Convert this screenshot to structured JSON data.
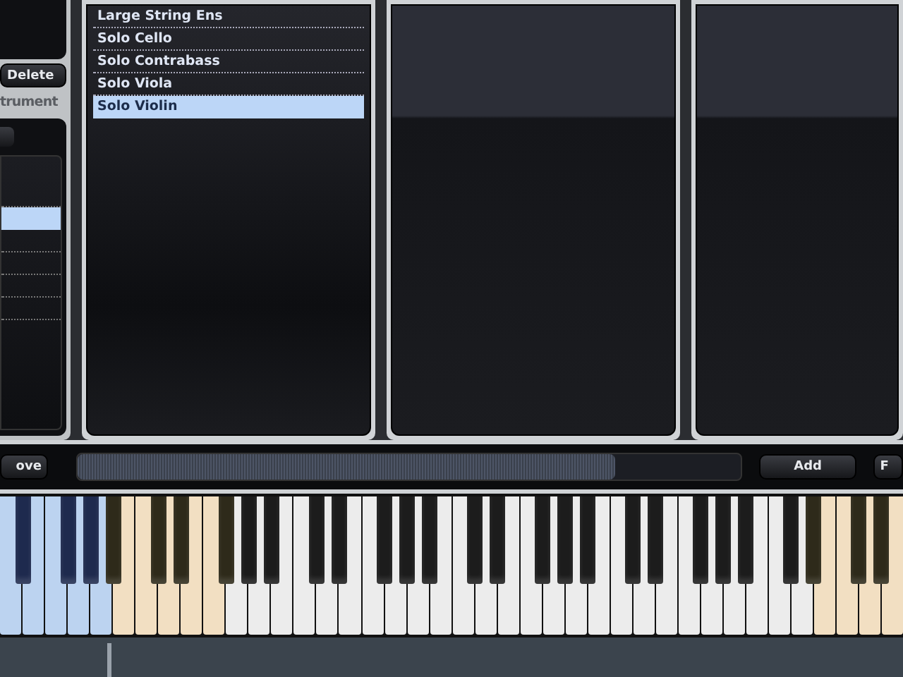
{
  "left_panel": {
    "delete_button": "Delete",
    "section_label": "trument",
    "section_disabled": true,
    "rows": [
      {
        "selected": false
      },
      {
        "selected": true
      },
      {
        "selected": false
      },
      {
        "selected": false
      },
      {
        "selected": false
      },
      {
        "selected": false
      }
    ]
  },
  "instrument_list": {
    "items": [
      {
        "label": "Large String Ens",
        "selected": false
      },
      {
        "label": "Solo Cello",
        "selected": false
      },
      {
        "label": "Solo Contrabass",
        "selected": false
      },
      {
        "label": "Solo Viola",
        "selected": false
      },
      {
        "label": "Solo Violin",
        "selected": true
      }
    ]
  },
  "transport": {
    "remove_button": "ove",
    "meter": {
      "level": 0.81
    },
    "add_button": "Add",
    "right_button": "F"
  },
  "keyboard": {
    "keys": [
      {
        "kind": "white",
        "color": "#bcd3f0"
      },
      {
        "kind": "black",
        "color": "#1e2a4e"
      },
      {
        "kind": "white",
        "color": "#bcd3f0"
      },
      {
        "kind": "white",
        "color": "#bcd3f0"
      },
      {
        "kind": "black",
        "color": "#1e2a4e"
      },
      {
        "kind": "white",
        "color": "#bcd3f0"
      },
      {
        "kind": "black",
        "color": "#1e2a4e"
      },
      {
        "kind": "white",
        "color": "#bcd3f0"
      },
      {
        "kind": "black",
        "color": "#2e2a1a"
      },
      {
        "kind": "white",
        "color": "#f2dfc2"
      },
      {
        "kind": "white",
        "color": "#f2dfc2"
      },
      {
        "kind": "black",
        "color": "#2e2a1a"
      },
      {
        "kind": "white",
        "color": "#f2dfc2"
      },
      {
        "kind": "black",
        "color": "#2e2a1a"
      },
      {
        "kind": "white",
        "color": "#f2dfc2"
      },
      {
        "kind": "white",
        "color": "#f2dfc2"
      },
      {
        "kind": "black",
        "color": "#2e2a1a"
      },
      {
        "kind": "white",
        "color": "#ececec"
      },
      {
        "kind": "black",
        "color": "#1c1c1c"
      },
      {
        "kind": "white",
        "color": "#ececec"
      },
      {
        "kind": "black",
        "color": "#1c1c1c"
      },
      {
        "kind": "white",
        "color": "#ececec"
      },
      {
        "kind": "white",
        "color": "#ececec"
      },
      {
        "kind": "black",
        "color": "#1c1c1c"
      },
      {
        "kind": "white",
        "color": "#ececec"
      },
      {
        "kind": "black",
        "color": "#1c1c1c"
      },
      {
        "kind": "white",
        "color": "#ececec"
      },
      {
        "kind": "white",
        "color": "#ececec"
      },
      {
        "kind": "black",
        "color": "#1c1c1c"
      },
      {
        "kind": "white",
        "color": "#ececec"
      },
      {
        "kind": "black",
        "color": "#1c1c1c"
      },
      {
        "kind": "white",
        "color": "#ececec"
      },
      {
        "kind": "black",
        "color": "#1c1c1c"
      },
      {
        "kind": "white",
        "color": "#ececec"
      },
      {
        "kind": "white",
        "color": "#ececec"
      },
      {
        "kind": "black",
        "color": "#1c1c1c"
      },
      {
        "kind": "white",
        "color": "#ececec"
      },
      {
        "kind": "black",
        "color": "#1c1c1c"
      },
      {
        "kind": "white",
        "color": "#ececec"
      },
      {
        "kind": "white",
        "color": "#ececec"
      },
      {
        "kind": "black",
        "color": "#1c1c1c"
      },
      {
        "kind": "white",
        "color": "#ececec"
      },
      {
        "kind": "black",
        "color": "#1c1c1c"
      },
      {
        "kind": "white",
        "color": "#ececec"
      },
      {
        "kind": "black",
        "color": "#1c1c1c"
      },
      {
        "kind": "white",
        "color": "#ececec"
      },
      {
        "kind": "white",
        "color": "#ececec"
      },
      {
        "kind": "black",
        "color": "#1c1c1c"
      },
      {
        "kind": "white",
        "color": "#ececec"
      },
      {
        "kind": "black",
        "color": "#1c1c1c"
      },
      {
        "kind": "white",
        "color": "#ececec"
      },
      {
        "kind": "white",
        "color": "#ececec"
      },
      {
        "kind": "black",
        "color": "#1c1c1c"
      },
      {
        "kind": "white",
        "color": "#ececec"
      },
      {
        "kind": "black",
        "color": "#1c1c1c"
      },
      {
        "kind": "white",
        "color": "#ececec"
      },
      {
        "kind": "black",
        "color": "#1c1c1c"
      },
      {
        "kind": "white",
        "color": "#ececec"
      },
      {
        "kind": "white",
        "color": "#ececec"
      },
      {
        "kind": "black",
        "color": "#1c1c1c"
      },
      {
        "kind": "white",
        "color": "#ececec"
      },
      {
        "kind": "black",
        "color": "#2e2a1a"
      },
      {
        "kind": "white",
        "color": "#f2dfc2"
      },
      {
        "kind": "white",
        "color": "#f2dfc2"
      },
      {
        "kind": "black",
        "color": "#2e2a1a"
      },
      {
        "kind": "white",
        "color": "#f2dfc2"
      },
      {
        "kind": "black",
        "color": "#2e2a1a"
      },
      {
        "kind": "white",
        "color": "#f2dfc2"
      }
    ]
  }
}
